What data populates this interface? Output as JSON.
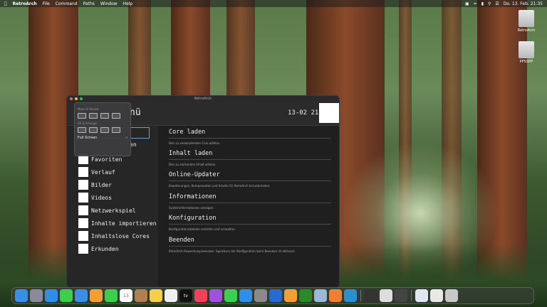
{
  "menubar": {
    "app": "RetroArch",
    "items": [
      "File",
      "Command",
      "Paths",
      "Window",
      "Help"
    ],
    "datetime": "Do. 13. Feb. 21:35"
  },
  "desktop": {
    "icons": [
      {
        "label": "RetroArch"
      },
      {
        "label": "PPSSPP"
      }
    ]
  },
  "window": {
    "title": "RetroArch",
    "header_title": "nü",
    "clock": "13-02 21:"
  },
  "popover": {
    "section1": "Move & Resize",
    "section2": "Fill & Arrange",
    "full_screen": "Full Screen",
    "chevron": "›"
  },
  "sidebar": {
    "items": [
      {
        "label": "Favoriten"
      },
      {
        "label": "Verlauf"
      },
      {
        "label": "Bilder"
      },
      {
        "label": "Videos"
      },
      {
        "label": "Netzwerkspiel"
      },
      {
        "label": "Inhalte importieren"
      },
      {
        "label": "Inhaltslose Cores"
      },
      {
        "label": "Erkunden"
      }
    ],
    "partial": "en"
  },
  "main": {
    "entries": [
      {
        "label": "Core laden",
        "desc": "Den zu verwendenden Core wählen."
      },
      {
        "label": "Inhalt laden",
        "desc": "Den zu startenden Inhalt wählen."
      },
      {
        "label": "Online-Updater",
        "desc": "Erweiterungen, Komponenten und Inhalte für RetroArch herunterladen."
      },
      {
        "label": "Informationen",
        "desc": "Systeminformationen anzeigen."
      },
      {
        "label": "Konfiguration",
        "desc": "Konfigurationsdateien erstellen und verwalten."
      },
      {
        "label": "Beenden",
        "desc": "RetroArch-Anwendung beenden. Speichern der Konfiguration beim Beenden ist aktiviert."
      }
    ]
  },
  "dock": {
    "apps": [
      {
        "icon": "finder-icon",
        "color": "#3a8ee6"
      },
      {
        "icon": "launchpad-icon",
        "color": "#8a8a9a"
      },
      {
        "icon": "safari-icon",
        "color": "#2f8fe8"
      },
      {
        "icon": "messages-icon",
        "color": "#3ccf4e"
      },
      {
        "icon": "mail-icon",
        "color": "#3a8ee6"
      },
      {
        "icon": "photos-icon",
        "color": "#f0a030"
      },
      {
        "icon": "facetime-icon",
        "color": "#3ccf4e"
      },
      {
        "icon": "calendar-icon",
        "color": "#ffffff",
        "text": "13"
      },
      {
        "icon": "contacts-icon",
        "color": "#b08050"
      },
      {
        "icon": "notes-icon",
        "color": "#f5d04a"
      },
      {
        "icon": "freeform-icon",
        "color": "#f0f0f0"
      },
      {
        "icon": "tv-icon",
        "color": "#111111",
        "text": "tv"
      },
      {
        "icon": "music-icon",
        "color": "#f5405a"
      },
      {
        "icon": "podcasts-icon",
        "color": "#a050e0"
      },
      {
        "icon": "numbers-icon",
        "color": "#3ccf4e"
      },
      {
        "icon": "appstore-icon",
        "color": "#2f8fe8"
      },
      {
        "icon": "settings-icon",
        "color": "#8a8a8a"
      },
      {
        "icon": "xcode-icon",
        "color": "#2a6ad0"
      },
      {
        "icon": "pencil-icon",
        "color": "#f0a030"
      },
      {
        "icon": "xbox-icon",
        "color": "#2a8a2a"
      },
      {
        "icon": "dolphin-icon",
        "color": "#9ab8d8"
      },
      {
        "icon": "retroarch-icon",
        "color": "#f08030"
      },
      {
        "icon": "ppsspp-icon",
        "color": "#2a90d0"
      },
      {
        "icon": "activity-icon",
        "color": "#333333"
      },
      {
        "icon": "script-icon",
        "color": "#dddddd"
      },
      {
        "icon": "game-icon",
        "color": "#444444"
      },
      {
        "icon": "preview-icon",
        "color": "#dfe8f0"
      },
      {
        "icon": "files-icon",
        "color": "#e8e8e8"
      },
      {
        "icon": "trash-icon",
        "color": "#c8c8c8"
      }
    ]
  }
}
